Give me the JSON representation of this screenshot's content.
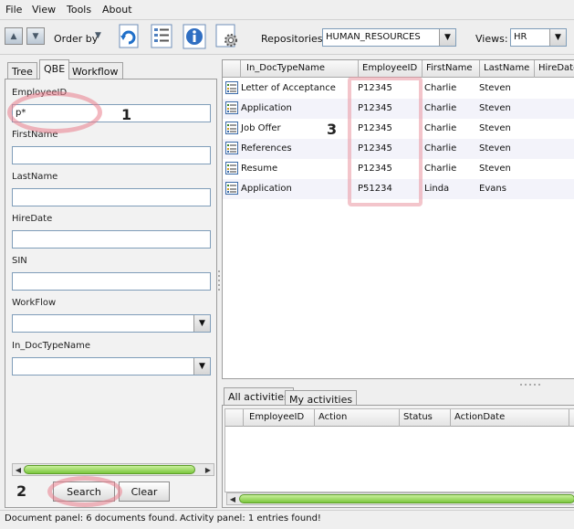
{
  "menu": [
    "File",
    "View",
    "Tools",
    "About"
  ],
  "toolbar": {
    "order_by": "Order by",
    "repositories_label": "Repositories:",
    "repository_value": "HUMAN_RESOURCES",
    "views_label": "Views:",
    "views_value": "HR",
    "icons": [
      "up-arrow-icon",
      "down-arrow-icon",
      "refresh-icon",
      "document-list-icon",
      "info-icon",
      "settings-icon"
    ]
  },
  "left": {
    "tabs": [
      "Tree",
      "QBE",
      "Workflow"
    ],
    "active_tab": "QBE",
    "fields": {
      "employee_id_label": "EmployeeID",
      "employee_id_value": "p*",
      "first_name_label": "FirstName",
      "last_name_label": "LastName",
      "hire_date_label": "HireDate",
      "sin_label": "SIN",
      "workflow_label": "WorkFlow",
      "doctype_label": "In_DocTypeName"
    },
    "search_button": "Search",
    "clear_button": "Clear"
  },
  "documents": {
    "columns": [
      "In_DocTypeName",
      "EmployeeID",
      "FirstName",
      "LastName",
      "HireDate"
    ],
    "rows": [
      [
        "Letter of Acceptance",
        "P12345",
        "Charlie",
        "Steven"
      ],
      [
        "Application",
        "P12345",
        "Charlie",
        "Steven"
      ],
      [
        "Job Offer",
        "P12345",
        "Charlie",
        "Steven"
      ],
      [
        "References",
        "P12345",
        "Charlie",
        "Steven"
      ],
      [
        "Resume",
        "P12345",
        "Charlie",
        "Steven"
      ],
      [
        "Application",
        "P51234",
        "Linda",
        "Evans"
      ]
    ]
  },
  "activities": {
    "tabs": [
      "All activities",
      "My activities"
    ],
    "active_tab": "All activities",
    "columns": [
      "EmployeeID",
      "Action",
      "Status",
      "ActionDate"
    ]
  },
  "status": {
    "document_panel": "Document panel: 6 documents found.",
    "activity_panel": "Activity panel: 1 entries found!"
  },
  "annotations": [
    "1",
    "2",
    "3"
  ],
  "colors": {
    "annotation": "#e97d8c",
    "scroll_thumb": "#7cc83e",
    "alt_row": "#f3f3fa"
  }
}
